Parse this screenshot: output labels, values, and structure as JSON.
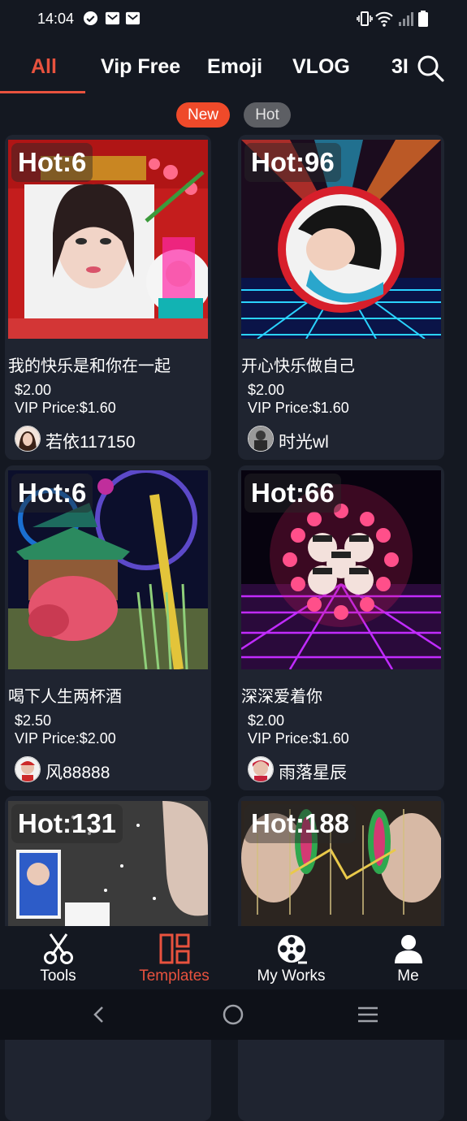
{
  "status_bar": {
    "time": "14:04",
    "icons": [
      "check-circle-icon",
      "mail-icon",
      "mail-icon",
      "vibrate-icon",
      "wifi-icon",
      "signal-icon",
      "battery-icon"
    ]
  },
  "tabs": [
    {
      "label": "All",
      "active": true
    },
    {
      "label": "Vip Free"
    },
    {
      "label": "Emoji"
    },
    {
      "label": "VLOG"
    },
    {
      "label": "3I"
    }
  ],
  "filters": {
    "new": "New",
    "hot": "Hot",
    "selected": "New"
  },
  "colors": {
    "accent": "#e8523e",
    "new_chip": "#ef4a2a",
    "card_bg": "#1f2430",
    "bg": "#141821"
  },
  "cards": [
    {
      "hot": "Hot:6",
      "title": "我的快乐是和你在一起",
      "price": "$2.00",
      "vip_price": "VIP Price:$1.60",
      "author": "若依117150"
    },
    {
      "hot": "Hot:96",
      "title": "开心快乐做自己",
      "price": "$2.00",
      "vip_price": "VIP Price:$1.60",
      "author": "时光wl"
    },
    {
      "hot": "Hot:6",
      "title": "喝下人生两杯酒",
      "price": "$2.50",
      "vip_price": "VIP Price:$2.00",
      "author": "风88888"
    },
    {
      "hot": "Hot:66",
      "title": "深深爱着你",
      "price": "$2.00",
      "vip_price": "VIP Price:$1.60",
      "author": "雨落星辰"
    },
    {
      "hot": "Hot:131"
    },
    {
      "hot": "Hot:188"
    }
  ],
  "bottom_nav": [
    {
      "label": "Tools",
      "icon": "scissors-icon"
    },
    {
      "label": "Templates",
      "icon": "templates-icon",
      "active": true
    },
    {
      "label": "My Works",
      "icon": "film-reel-icon"
    },
    {
      "label": "Me",
      "icon": "person-icon"
    }
  ]
}
